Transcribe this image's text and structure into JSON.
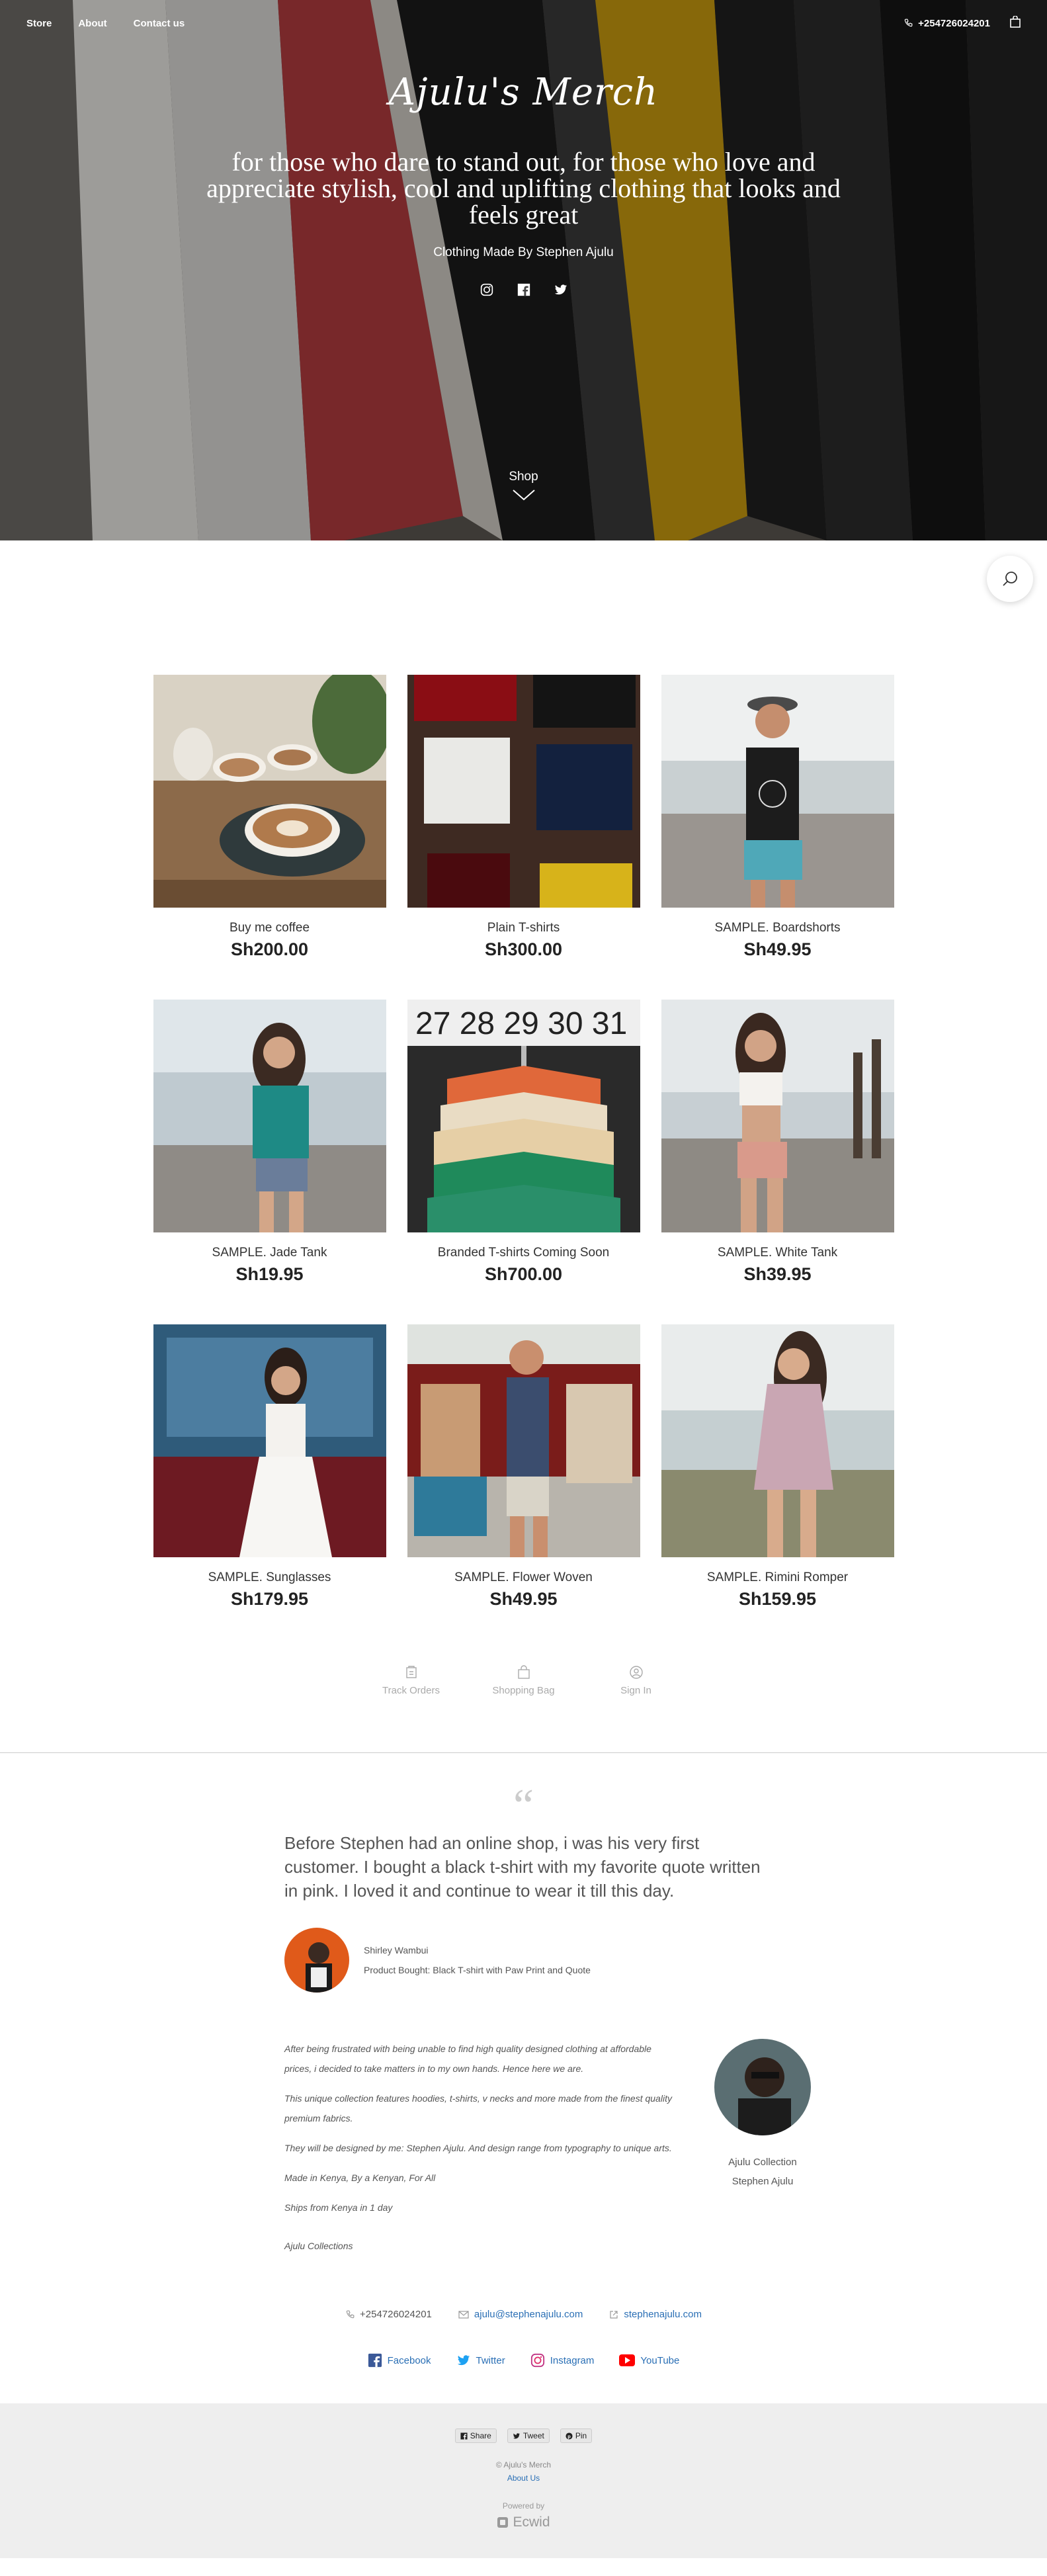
{
  "nav": {
    "store": "Store",
    "about": "About",
    "contact": "Contact us",
    "phone": "+254726024201"
  },
  "hero": {
    "logo": "Ajulu's Merch",
    "tagline": "for those who dare to stand out, for those who love and appreciate stylish, cool and uplifting clothing that looks and feels great",
    "subtitle": "Clothing Made By Stephen Ajulu",
    "shop": "Shop",
    "socials": [
      "instagram-icon",
      "facebook-icon",
      "twitter-icon"
    ]
  },
  "products": [
    {
      "name": "Buy me coffee",
      "price": "Sh200.00"
    },
    {
      "name": "Plain T-shirts",
      "price": "Sh300.00"
    },
    {
      "name": "SAMPLE. Boardshorts",
      "price": "Sh49.95"
    },
    {
      "name": "SAMPLE. Jade Tank",
      "price": "Sh19.95"
    },
    {
      "name": "Branded T-shirts Coming Soon",
      "price": "Sh700.00"
    },
    {
      "name": "SAMPLE. White Tank",
      "price": "Sh39.95"
    },
    {
      "name": "SAMPLE. Sunglasses",
      "price": "Sh179.95"
    },
    {
      "name": "SAMPLE. Flower Woven",
      "price": "Sh49.95"
    },
    {
      "name": "SAMPLE. Rimini Romper",
      "price": "Sh159.95"
    }
  ],
  "account": {
    "track": "Track Orders",
    "bag": "Shopping Bag",
    "signin": "Sign In"
  },
  "testimonial": {
    "quote_mark": "“",
    "text": "Before Stephen had an online shop, i was his very first customer. I bought a black t-shirt with my favorite quote written in pink. I loved it and continue to wear it till this day.",
    "author": "Shirley Wambui",
    "product": "Product Bought: Black T-shirt with Paw Print and Quote"
  },
  "about": {
    "p1": "After being frustrated with being unable to find high quality designed clothing at affordable prices, i decided to take matters in to my own hands. Hence here we are.",
    "p2": "This unique collection features hoodies, t-shirts, v necks and more made from the finest quality premium fabrics.",
    "p3": "They will be designed by me: Stephen Ajulu. And design range from typography to unique arts.",
    "p4": "Made in Kenya, By a Kenyan, For All",
    "p5": "Ships from Kenya in 1 day",
    "p6": "Ajulu Collections",
    "side_line1": "Ajulu Collection",
    "side_line2": "Stephen Ajulu"
  },
  "contact": {
    "phone": "+254726024201",
    "email": "ajulu@stephenajulu.com",
    "site": "stephenajulu.com"
  },
  "social_links": {
    "facebook": "Facebook",
    "twitter": "Twitter",
    "instagram": "Instagram",
    "youtube": "YouTube"
  },
  "footer": {
    "share": "Share",
    "tweet": "Tweet",
    "pin": "Pin",
    "copyright": "© Ajulu's Merch",
    "about_us": "About Us",
    "powered_by": "Powered by",
    "ecwid": "Ecwid"
  },
  "colors": {
    "link_blue": "#2a6fb5",
    "footer_bg": "#eeeeee",
    "divider": "#cccccc"
  }
}
